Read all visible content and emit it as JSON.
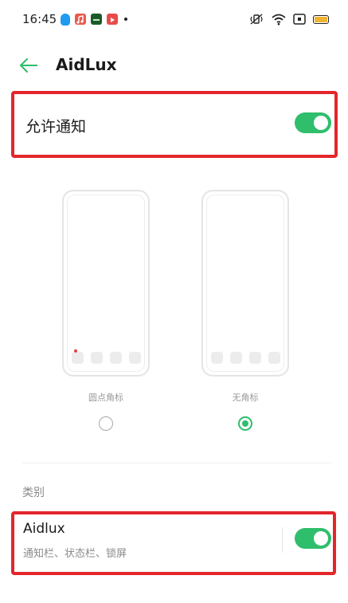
{
  "status_bar": {
    "time": "16:45",
    "notification_icons": [
      {
        "name": "qq-icon",
        "color": "#1e9cf0"
      },
      {
        "name": "music-app-icon",
        "color": "#e85a4f"
      },
      {
        "name": "green-app-icon",
        "color": "#1a5a2a"
      },
      {
        "name": "video-app-icon",
        "color": "#e94b4b"
      }
    ],
    "battery_color": "#f2b233"
  },
  "header": {
    "title": "AidLux",
    "accent": "#2fbe6b"
  },
  "allow_notifications": {
    "label": "允许通知",
    "enabled": true
  },
  "badge_styles": {
    "options": [
      {
        "label": "圆点角标",
        "selected": false
      },
      {
        "label": "无角标",
        "selected": true
      }
    ]
  },
  "category": {
    "section_label": "类别",
    "items": [
      {
        "title": "Aidlux",
        "subtitle": "通知栏、状态栏、锁屏",
        "enabled": true
      }
    ]
  },
  "colors": {
    "toggle_on": "#2fbe6b",
    "highlight_border": "#e3262b"
  }
}
